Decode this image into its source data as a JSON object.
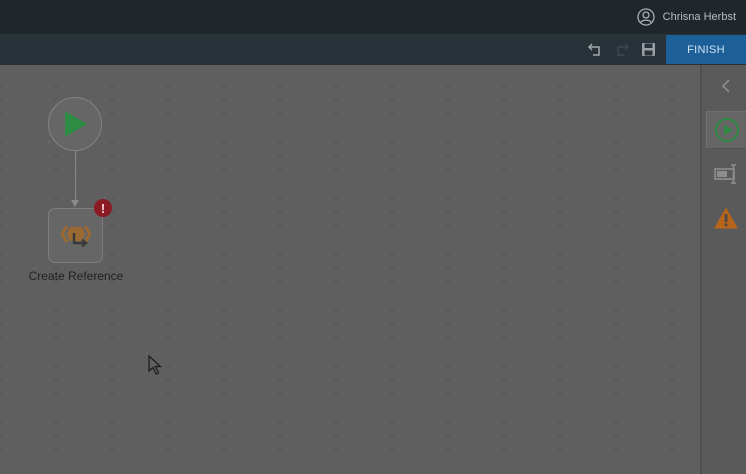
{
  "header": {
    "user_name": "Chrisna Herbst",
    "user_icon": "user-circle-icon"
  },
  "toolbar": {
    "undo_icon": "undo-icon",
    "redo_icon": "redo-icon",
    "save_icon": "save-icon",
    "finish_label": "FINISH"
  },
  "canvas": {
    "start_node_icon": "play-icon",
    "action_node": {
      "label": "Create Reference",
      "icon": "create-reference-icon",
      "error_badge": "!"
    }
  },
  "right_panel": {
    "items": [
      {
        "name": "collapse-panel",
        "icon": "chevron-left-icon"
      },
      {
        "name": "start",
        "icon": "play-circle-icon",
        "active": true
      },
      {
        "name": "input-field",
        "icon": "text-field-icon"
      },
      {
        "name": "warnings",
        "icon": "warning-icon"
      }
    ]
  },
  "colors": {
    "finish_button": "#1d5f99",
    "play_green": "#2e8b43",
    "error_red": "#8a1a24",
    "warning_orange": "#b8651c",
    "action_orange": "#9a6a32"
  }
}
